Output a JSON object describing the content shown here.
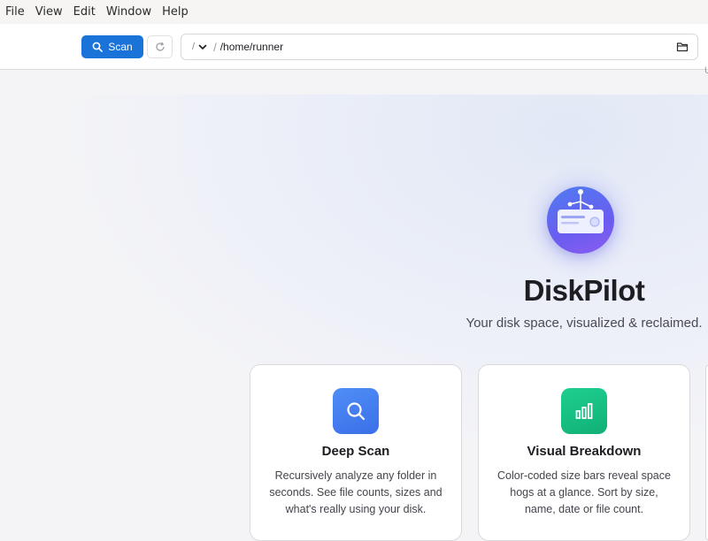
{
  "menubar": {
    "items": [
      "File",
      "View",
      "Edit",
      "Window",
      "Help"
    ]
  },
  "toolbar": {
    "scan_label": "Scan",
    "root_value": "/",
    "path_separator": "/",
    "path_value": "/home/runner",
    "edge_text": "U"
  },
  "hero": {
    "title": "DiskPilot",
    "tagline": "Your disk space, visualized & reclaimed."
  },
  "features": [
    {
      "title": "Deep Scan",
      "description": "Recursively analyze any folder in seconds. See file counts, sizes and what's really using your disk.",
      "icon": "search-icon",
      "color": "#3b82f6"
    },
    {
      "title": "Visual Breakdown",
      "description": "Color-coded size bars reveal space hogs at a glance. Sort by size, name, date or file count.",
      "icon": "bar-chart-icon",
      "color": "#16b981"
    }
  ],
  "colors": {
    "accent": "#1a73d9",
    "logo_gradient": [
      "#4f7cf0",
      "#8b5cf0"
    ]
  }
}
